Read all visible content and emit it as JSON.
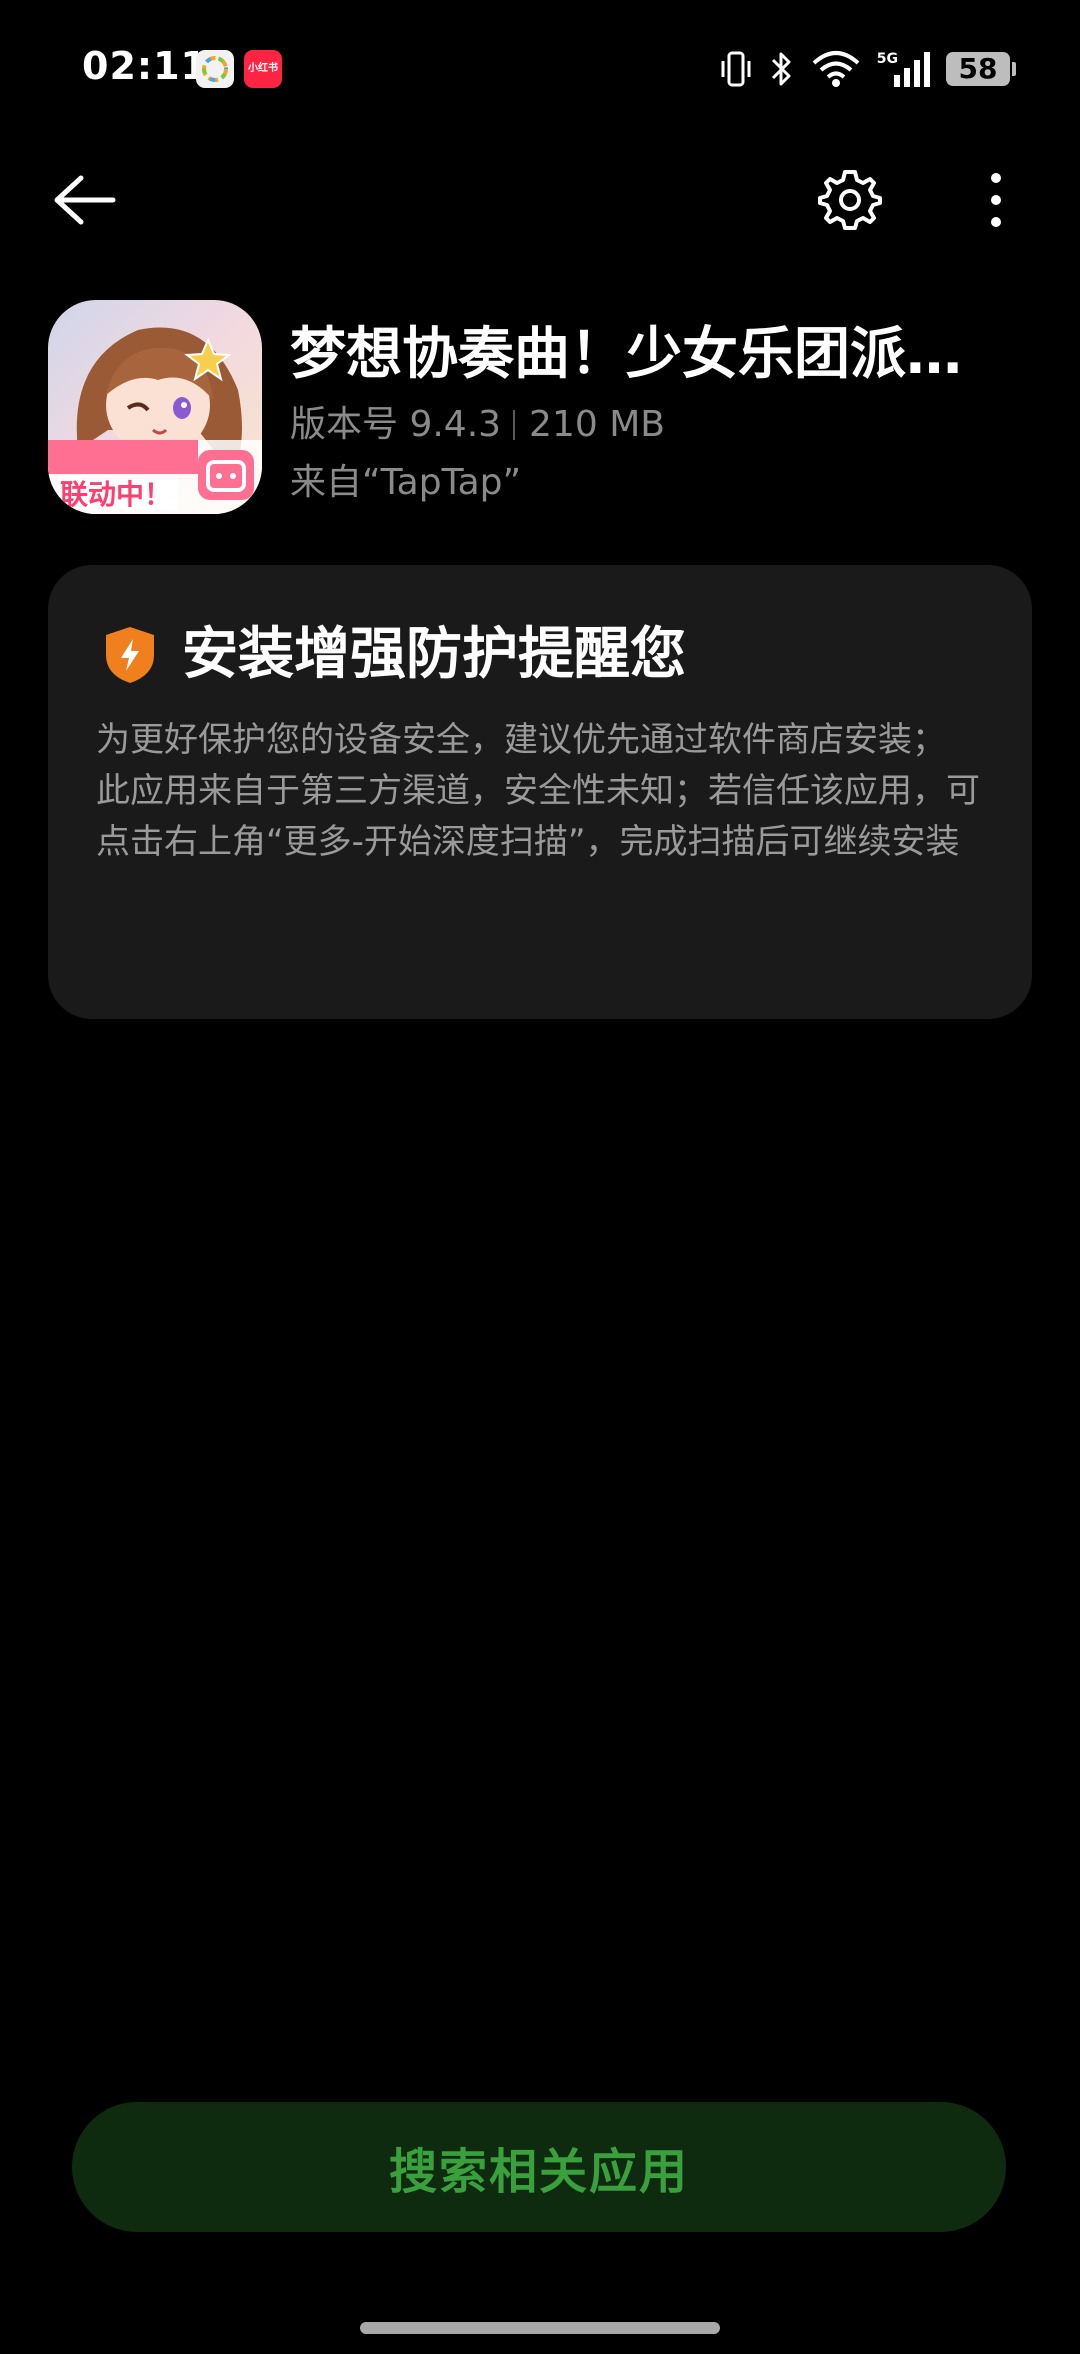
{
  "status_bar": {
    "time": "02:11",
    "notification_icons": [
      "gallery-icon",
      "xiaohongshu-icon"
    ],
    "xiaohongshu_label": "小红书",
    "network_label": "5G",
    "battery": "58"
  },
  "toolbar": {
    "back_icon": "back-arrow-icon",
    "settings_icon": "gear-icon",
    "more_icon": "more-vertical-icon"
  },
  "app": {
    "name": "梦想协奏曲！少女乐团派…",
    "version": "版本号 9.4.3",
    "size": "210 MB",
    "source": "来自“TapTap”",
    "icon_text": "联动中！"
  },
  "warning": {
    "title": "安装增强防护提醒您",
    "line1": "为更好保护您的设备安全，建议优先通过软件商店安装；",
    "line2": "此应用来自于第三方渠道，安全性未知；若信任该应用，可点击右上角“更多-开始深度扫描”，完成扫描后可继续安装",
    "icon": "shield-icon",
    "accent_color": "#f07f1e"
  },
  "actions": {
    "search_related": "搜索相关应用",
    "button_text_color": "#3aa03d",
    "button_bg_color": "#0e2a0f"
  }
}
